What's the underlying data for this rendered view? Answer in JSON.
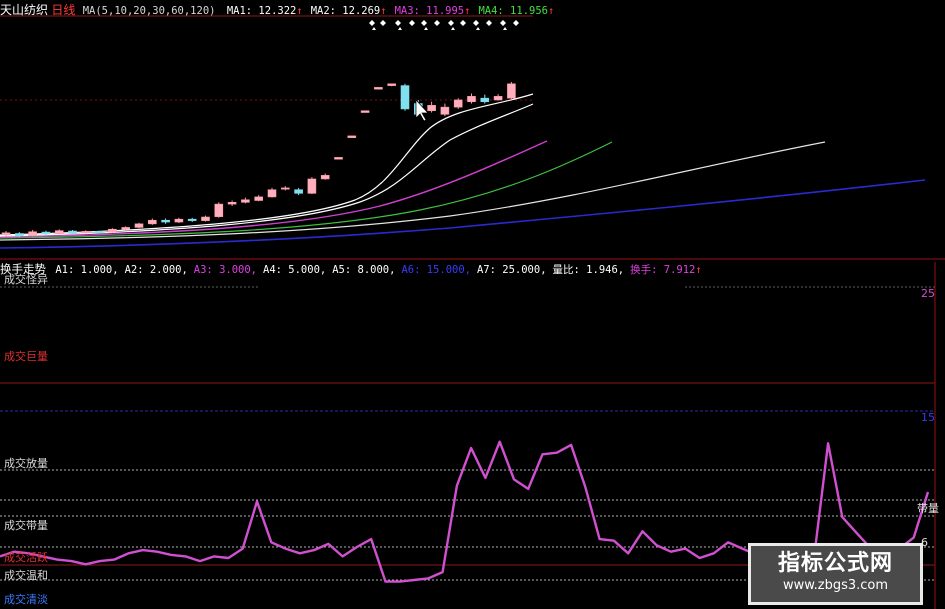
{
  "top_panel": {
    "stock_name": "天山纺织",
    "period": "日线",
    "ma_params": "MA(5,10,20,30,60,120)",
    "ma_values": [
      {
        "label": "MA1: 12.322",
        "arrow": "↑",
        "color": "#ffffff"
      },
      {
        "label": "MA2: 12.269",
        "arrow": "↑",
        "color": "#ffffff"
      },
      {
        "label": "MA3: 11.995",
        "arrow": "↑",
        "color": "#e040e0"
      },
      {
        "label": "MA4: 11.956",
        "arrow": "↑",
        "color": "#40e040"
      }
    ]
  },
  "bottom_panel": {
    "indicator_name": "换手走势",
    "params": [
      {
        "label": "A1: 1.000,",
        "color": "#ffffff"
      },
      {
        "label": "A2: 2.000,",
        "color": "#ffffff"
      },
      {
        "label": "A3: 3.000,",
        "color": "#e040e0"
      },
      {
        "label": "A4: 5.000,",
        "color": "#ffffff"
      },
      {
        "label": "A5: 8.000,",
        "color": "#ffffff"
      },
      {
        "label": "A6: 15.000,",
        "color": "#3a3aff"
      },
      {
        "label": "A7: 25.000,",
        "color": "#ffffff"
      },
      {
        "label": "量比: 1.946,",
        "color": "#ffffff"
      },
      {
        "label": "换手: 7.912",
        "color": "#e040e0",
        "arrow": "↑"
      }
    ],
    "levels": {
      "l25": "成交怪异",
      "l15": "成交巨量",
      "l8": "成交放量",
      "l5": "成交带量",
      "l3": "成交活跃",
      "l2": "成交温和",
      "l1": "成交清淡"
    },
    "right_labels": {
      "r25": "25",
      "r15": "15",
      "r5": "带量",
      "r3": "6"
    },
    "turnover_series": [
      2.5,
      2.8,
      2.7,
      2.5,
      2.3,
      2.2,
      2.0,
      2.2,
      2.3,
      2.7,
      2.9,
      2.8,
      2.6,
      2.5,
      2.2,
      2.5,
      2.4,
      3.0,
      6.0,
      3.4,
      3.0,
      2.7,
      2.9,
      3.3,
      2.5,
      3.1,
      3.6,
      0.9,
      0.9,
      1.0,
      1.1,
      1.5,
      7.0,
      9.4,
      7.5,
      9.8,
      7.4,
      6.8,
      9.0,
      9.1,
      9.6,
      6.9,
      3.6,
      3.5,
      2.7,
      4.1,
      3.2,
      2.8,
      3.0,
      2.4,
      2.7,
      3.4,
      3.0,
      2.6,
      2.8,
      2.6,
      2.5,
      2.3,
      9.7,
      5.0,
      4.0,
      3.0,
      3.2,
      3.0,
      3.7,
      6.6
    ]
  },
  "price_chart": {
    "candles": [
      {
        "o": 8.75,
        "c": 8.8,
        "h": 8.85,
        "l": 8.7
      },
      {
        "o": 8.78,
        "c": 8.72,
        "h": 8.82,
        "l": 8.68
      },
      {
        "o": 8.72,
        "c": 8.83,
        "h": 8.88,
        "l": 8.7
      },
      {
        "o": 8.82,
        "c": 8.78,
        "h": 8.86,
        "l": 8.74
      },
      {
        "o": 8.78,
        "c": 8.86,
        "h": 8.9,
        "l": 8.75
      },
      {
        "o": 8.85,
        "c": 8.8,
        "h": 8.88,
        "l": 8.77
      },
      {
        "o": 8.8,
        "c": 8.84,
        "h": 8.87,
        "l": 8.78
      },
      {
        "o": 8.84,
        "c": 8.82,
        "h": 8.86,
        "l": 8.79
      },
      {
        "o": 8.82,
        "c": 8.9,
        "h": 8.93,
        "l": 8.8
      },
      {
        "o": 8.9,
        "c": 8.95,
        "h": 8.98,
        "l": 8.87
      },
      {
        "o": 8.95,
        "c": 9.05,
        "h": 9.08,
        "l": 8.93
      },
      {
        "o": 9.05,
        "c": 9.15,
        "h": 9.2,
        "l": 9.02
      },
      {
        "o": 9.15,
        "c": 9.1,
        "h": 9.2,
        "l": 9.05
      },
      {
        "o": 9.1,
        "c": 9.18,
        "h": 9.22,
        "l": 9.07
      },
      {
        "o": 9.18,
        "c": 9.14,
        "h": 9.22,
        "l": 9.1
      },
      {
        "o": 9.14,
        "c": 9.24,
        "h": 9.28,
        "l": 9.12
      },
      {
        "o": 9.25,
        "c": 9.6,
        "h": 9.65,
        "l": 9.22
      },
      {
        "o": 9.6,
        "c": 9.65,
        "h": 9.7,
        "l": 9.55
      },
      {
        "o": 9.65,
        "c": 9.72,
        "h": 9.78,
        "l": 9.62
      },
      {
        "o": 9.7,
        "c": 9.8,
        "h": 9.85,
        "l": 9.68
      },
      {
        "o": 9.8,
        "c": 10.0,
        "h": 10.05,
        "l": 9.78
      },
      {
        "o": 10.02,
        "c": 10.05,
        "h": 10.1,
        "l": 9.98
      },
      {
        "o": 10.0,
        "c": 9.9,
        "h": 10.05,
        "l": 9.85
      },
      {
        "o": 9.9,
        "c": 10.3,
        "h": 10.35,
        "l": 9.88
      },
      {
        "o": 10.3,
        "c": 10.4,
        "h": 10.45,
        "l": 10.28
      },
      {
        "o": 10.85,
        "c": 10.9,
        "h": 10.9,
        "l": 10.85
      },
      {
        "o": 11.45,
        "c": 11.5,
        "h": 11.5,
        "l": 11.45
      },
      {
        "o": 12.15,
        "c": 12.2,
        "h": 12.2,
        "l": 12.15
      },
      {
        "o": 12.8,
        "c": 12.85,
        "h": 12.85,
        "l": 12.8
      },
      {
        "o": 12.9,
        "c": 12.95,
        "h": 12.95,
        "l": 12.88
      },
      {
        "o": 12.9,
        "c": 12.25,
        "h": 12.95,
        "l": 12.2
      },
      {
        "o": 12.4,
        "c": 12.1,
        "h": 12.5,
        "l": 12.05
      },
      {
        "o": 12.2,
        "c": 12.35,
        "h": 12.45,
        "l": 12.15
      },
      {
        "o": 12.1,
        "c": 12.3,
        "h": 12.4,
        "l": 12.05
      },
      {
        "o": 12.3,
        "c": 12.5,
        "h": 12.55,
        "l": 12.25
      },
      {
        "o": 12.45,
        "c": 12.6,
        "h": 12.68,
        "l": 12.4
      },
      {
        "o": 12.55,
        "c": 12.45,
        "h": 12.65,
        "l": 12.4
      },
      {
        "o": 12.5,
        "c": 12.6,
        "h": 12.66,
        "l": 12.48
      },
      {
        "o": 12.55,
        "c": 12.95,
        "h": 13.0,
        "l": 12.5
      }
    ]
  }
}
